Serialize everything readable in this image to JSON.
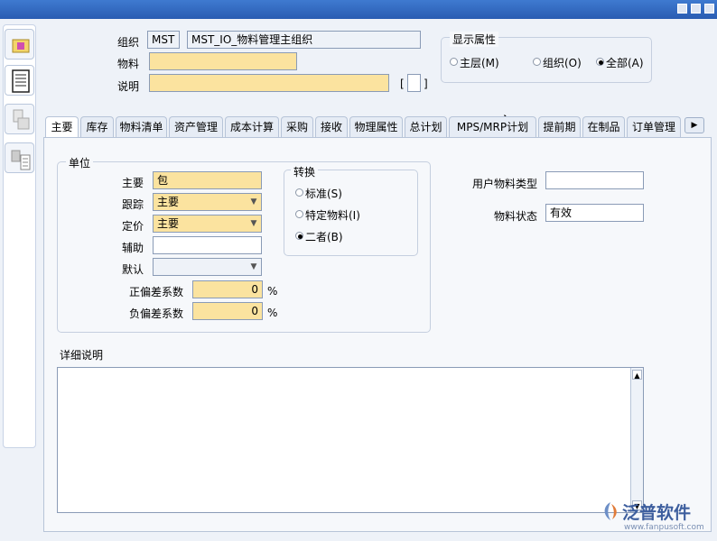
{
  "header": {
    "org_label": "组织",
    "org_code": "MST",
    "org_name": "MST_IO_物料管理主组织",
    "item_label": "物料",
    "item_value": "",
    "desc_label": "说明",
    "desc_value": "",
    "bracket_open": "[",
    "bracket_close": "]"
  },
  "display": {
    "title": "显示属性",
    "options": [
      {
        "label": "主层(M)",
        "selected": false
      },
      {
        "label": "组织(O)",
        "selected": false
      },
      {
        "label": "全部(A)",
        "selected": true
      }
    ]
  },
  "tabs": [
    "主要",
    "库存",
    "物料清单",
    "资产管理",
    "成本计算",
    "采购",
    "接收",
    "物理属性",
    "总计划",
    "MPS/MRP计划",
    "提前期",
    "在制品",
    "订单管理"
  ],
  "active_tab": 0,
  "units": {
    "title": "单位",
    "primary_label": "主要",
    "primary_value": "包",
    "tracking_label": "跟踪",
    "tracking_value": "主要",
    "pricing_label": "定价",
    "pricing_value": "主要",
    "secondary_label": "辅助",
    "secondary_value": "",
    "default_label": "默认",
    "default_value": "",
    "pos_dev_label": "正偏差系数",
    "pos_dev_value": "0",
    "neg_dev_label": "负偏差系数",
    "neg_dev_value": "0",
    "percent": "%"
  },
  "conversion": {
    "title": "转换",
    "options": [
      {
        "label": "标准(S)",
        "selected": false
      },
      {
        "label": "特定物料(I)",
        "selected": false
      },
      {
        "label": "二者(B)",
        "selected": true
      }
    ]
  },
  "right": {
    "user_type_label": "用户物料类型",
    "user_type_value": "",
    "status_label": "物料状态",
    "status_value": "有效"
  },
  "detail": {
    "label": "详细说明",
    "value": ""
  },
  "watermark": {
    "text": "泛普软件",
    "url": "www.fanpusoft.com"
  },
  "colors": {
    "required_field": "#fbe39f",
    "titlebar": "#2a5cb2",
    "panel": "#f6f8fb"
  }
}
